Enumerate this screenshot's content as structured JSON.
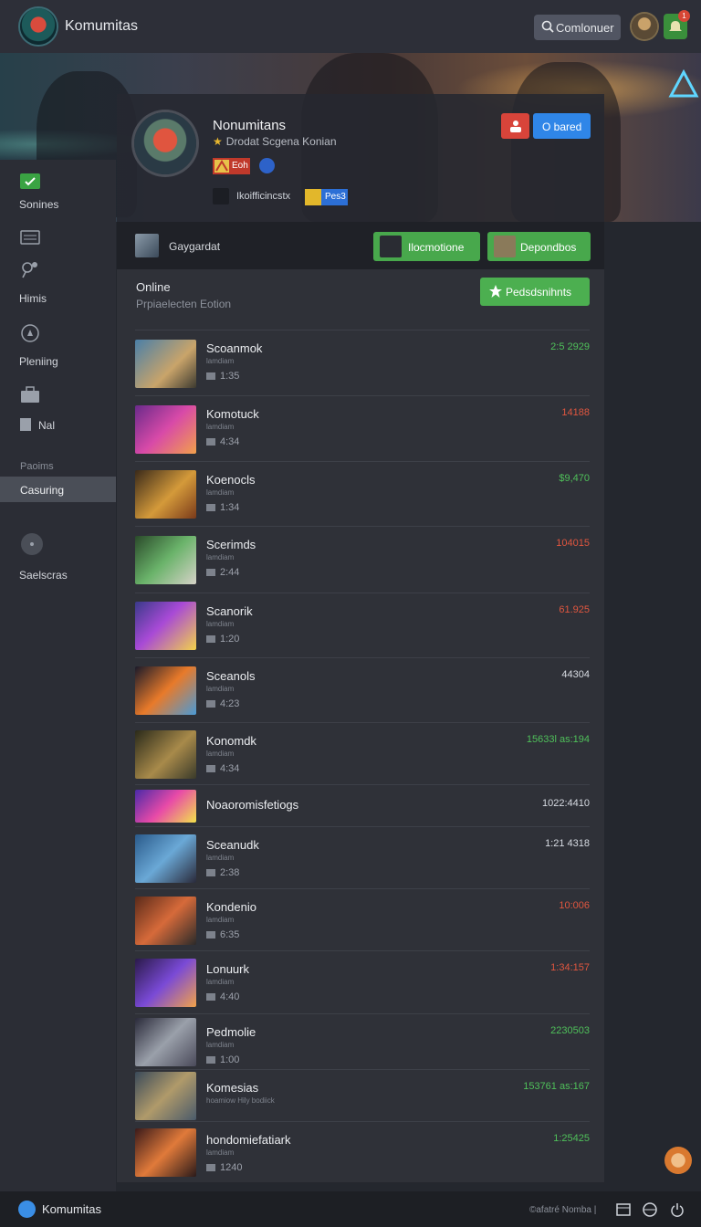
{
  "header": {
    "app_title": "Komumitas",
    "search_label": "Comlonuer",
    "notification_count": "1"
  },
  "profile": {
    "name": "Nonumitans",
    "subtitle": "Drodat Scgena Konian",
    "tag_red": "Eoh",
    "tag_line": "Ikoifficincstx",
    "tag_blue": "Pes3",
    "btn_blue": "O bared"
  },
  "sidebar": {
    "items": [
      {
        "label": "Sonines",
        "icon": "chat-icon"
      },
      {
        "label": "",
        "icon": "list-icon"
      },
      {
        "label": "Himis",
        "icon": "users-icon"
      },
      {
        "label": "Pleniing",
        "icon": "compass-icon"
      },
      {
        "label": "Nal",
        "icon": "briefcase-icon"
      }
    ],
    "section_label": "Paoims",
    "active_item": "Casuring",
    "bottom_item": "Saelscras"
  },
  "group_bar": {
    "label": "Gaygardat",
    "btn1": "Ilocmotione",
    "btn2": "Depondbos"
  },
  "online": {
    "title": "Online",
    "subtitle": "Prpiaelecten Eotion",
    "add_button": "Pedsdsnihnts"
  },
  "players": [
    {
      "name": "Scoanmok",
      "meta": "lamdiam",
      "stat": "1:35",
      "value": "2:5 2929",
      "value_color": "#4fc05a"
    },
    {
      "name": "Komotuck",
      "meta": "lamdiam",
      "stat": "4:34",
      "value": "14188",
      "value_color": "#e0563f"
    },
    {
      "name": "Koenocls",
      "meta": "lamdiam",
      "stat": "1:34",
      "value": "$9,470",
      "value_color": "#4fc05a"
    },
    {
      "name": "Scerimds",
      "meta": "lamdiam",
      "stat": "2:44",
      "value": "104015",
      "value_color": "#e0563f"
    },
    {
      "name": "Scanorik",
      "meta": "lamdiam",
      "stat": "1:20",
      "value": "61.925",
      "value_color": "#e0563f"
    },
    {
      "name": "Sceanols",
      "meta": "lamdiam",
      "stat": "4:23",
      "value": "44304",
      "value_color": "#d8dce3"
    },
    {
      "name": "Konomdk",
      "meta": "lamdiam",
      "stat": "4:34",
      "value": "15633l as:194",
      "value_color": "#4fc05a"
    },
    {
      "name": "Noaoromisfetiogs",
      "meta": "",
      "stat": "",
      "value": "1022:4410",
      "value_color": "#d8dce3"
    },
    {
      "name": "Sceanudk",
      "meta": "lamdiam",
      "stat": "2:38",
      "value": "1:21 4318",
      "value_color": "#d8dce3"
    },
    {
      "name": "Kondenio",
      "meta": "lamdiam",
      "stat": "6:35",
      "value": "10:006",
      "value_color": "#e0563f"
    },
    {
      "name": "Lonuurk",
      "meta": "lamdiam",
      "stat": "4:40",
      "value": "1:34:157",
      "value_color": "#e0563f"
    },
    {
      "name": "Pedmolie",
      "meta": "lamdiam",
      "stat": "1:00",
      "value": "2230503",
      "value_color": "#4fc05a"
    },
    {
      "name": "Komesias",
      "meta": "hoamiow Hily bodiick",
      "stat": "",
      "value": "153761 as:167",
      "value_color": "#4fc05a"
    },
    {
      "name": "hondomiefatiark",
      "meta": "lamdiam",
      "stat": "1240",
      "value": "1:25425",
      "value_color": "#4fc05a"
    }
  ],
  "footer": {
    "title": "Komumitas",
    "right_text": "©afatré Nomba |"
  }
}
